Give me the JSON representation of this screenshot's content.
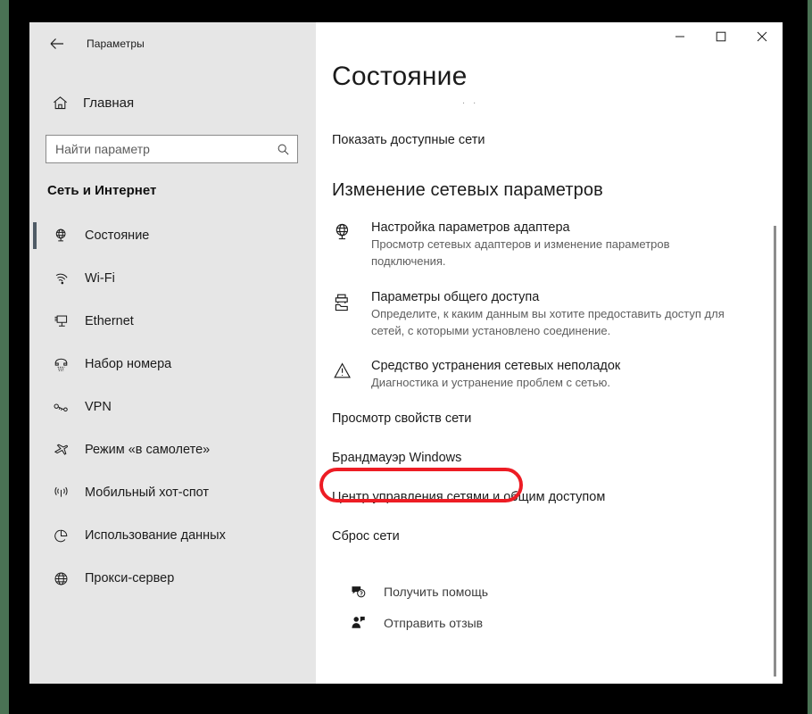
{
  "window": {
    "app_title": "Параметры",
    "back_icon": "back-arrow-icon",
    "controls": {
      "minimize": "—",
      "maximize": "▢",
      "close": "✕"
    }
  },
  "sidebar": {
    "home": {
      "label": "Главная",
      "icon": "home-icon"
    },
    "search": {
      "placeholder": "Найти параметр",
      "value": "",
      "icon": "search-icon"
    },
    "section_title": "Сеть и Интернет",
    "items": [
      {
        "label": "Состояние",
        "icon": "globe-monitor-icon",
        "selected": true
      },
      {
        "label": "Wi-Fi",
        "icon": "wifi-icon",
        "selected": false
      },
      {
        "label": "Ethernet",
        "icon": "ethernet-icon",
        "selected": false
      },
      {
        "label": "Набор номера",
        "icon": "dialup-phone-icon",
        "selected": false
      },
      {
        "label": "VPN",
        "icon": "vpn-key-icon",
        "selected": false
      },
      {
        "label": "Режим «в самолете»",
        "icon": "airplane-icon",
        "selected": false
      },
      {
        "label": "Мобильный хот-спот",
        "icon": "hotspot-icon",
        "selected": false
      },
      {
        "label": "Использование данных",
        "icon": "pie-chart-icon",
        "selected": false
      },
      {
        "label": "Прокси-сервер",
        "icon": "globe-icon",
        "selected": false
      }
    ]
  },
  "main": {
    "page_title": "Состояние",
    "ghost_marks": ". .",
    "show_networks_link": "Показать доступные сети",
    "change_settings_heading": "Изменение сетевых параметров",
    "features": [
      {
        "title": "Настройка параметров адаптера",
        "desc": "Просмотр сетевых адаптеров и изменение параметров подключения.",
        "icon": "adapter-globe-icon"
      },
      {
        "title": "Параметры общего доступа",
        "desc": "Определите, к каким данным вы хотите предоставить доступ для сетей, с которыми установлено соединение.",
        "icon": "sharing-folder-icon"
      },
      {
        "title": "Средство устранения сетевых неполадок",
        "desc": "Диагностика и устранение проблем с сетью.",
        "icon": "warning-triangle-icon"
      }
    ],
    "links": [
      {
        "label": "Просмотр свойств сети",
        "highlighted": false
      },
      {
        "label": "Брандмауэр Windows",
        "highlighted": true
      },
      {
        "label": "Центр управления сетями и общим доступом",
        "highlighted": false
      },
      {
        "label": "Сброс сети",
        "highlighted": false
      }
    ],
    "help": [
      {
        "label": "Получить помощь",
        "icon": "help-chat-icon"
      },
      {
        "label": "Отправить отзыв",
        "icon": "feedback-person-icon"
      }
    ]
  },
  "annotation": {
    "highlight_color": "#ed1c24",
    "target_label": "Брандмауэр Windows"
  }
}
